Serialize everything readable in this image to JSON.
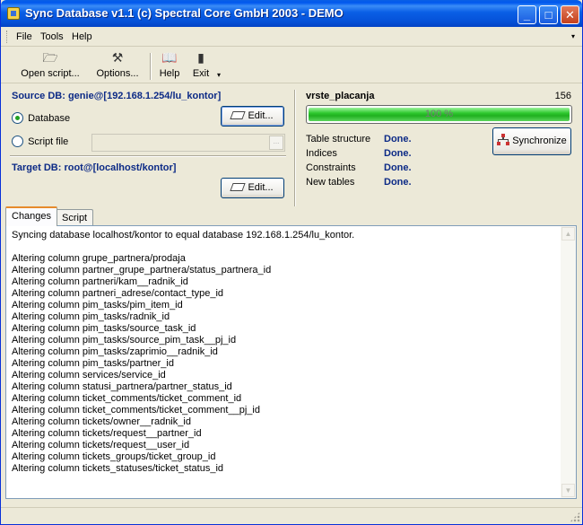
{
  "window": {
    "title": "Sync Database v1.1 (c) Spectral Core GmbH 2003 - DEMO",
    "controls": {
      "minimize": "_",
      "maximize": "□",
      "close": "✕"
    }
  },
  "menu": {
    "items": [
      "File",
      "Tools",
      "Help"
    ],
    "overflow": "▾"
  },
  "toolbar": {
    "open_script": "Open script...",
    "options": "Options...",
    "help": "Help",
    "exit": "Exit",
    "dropdown": "▾",
    "icons": {
      "open_script": "folder-open-icon",
      "options": "wrench-icon",
      "help": "book-icon",
      "exit": "door-icon"
    }
  },
  "source": {
    "label": "Source DB: genie@[192.168.1.254/lu_kontor]",
    "edit_label": "Edit...",
    "radio_database": "Database",
    "radio_script": "Script file",
    "selected": "Database",
    "script_file_value": "",
    "browse": "..."
  },
  "target": {
    "label": "Target DB: root@[localhost/kontor]",
    "edit_label": "Edit..."
  },
  "progress": {
    "current_table": "vrste_placanja",
    "count": "156",
    "percent_label": "100 %",
    "fraction": 1.0
  },
  "status": [
    {
      "label": "Table structure",
      "value": "Done."
    },
    {
      "label": "Indices",
      "value": "Done."
    },
    {
      "label": "Constraints",
      "value": "Done."
    },
    {
      "label": "New tables",
      "value": "Done."
    }
  ],
  "synchronize_label": "Synchronize",
  "tabs": [
    {
      "label": "Changes",
      "active": true
    },
    {
      "label": "Script",
      "active": false
    }
  ],
  "log": [
    "Syncing database localhost/kontor to equal database 192.168.1.254/lu_kontor.",
    "",
    "Altering column grupe_partnera/prodaja",
    "Altering column partner_grupe_partnera/status_partnera_id",
    "Altering column partneri/kam__radnik_id",
    "Altering column partneri_adrese/contact_type_id",
    "Altering column pim_tasks/pim_item_id",
    "Altering column pim_tasks/radnik_id",
    "Altering column pim_tasks/source_task_id",
    "Altering column pim_tasks/source_pim_task__pj_id",
    "Altering column pim_tasks/zaprimio__radnik_id",
    "Altering column pim_tasks/partner_id",
    "Altering column services/service_id",
    "Altering column statusi_partnera/partner_status_id",
    "Altering column ticket_comments/ticket_comment_id",
    "Altering column ticket_comments/ticket_comment__pj_id",
    "Altering column tickets/owner__radnik_id",
    "Altering column tickets/request__partner_id",
    "Altering column tickets/request__user_id",
    "Altering column tickets_groups/ticket_group_id",
    "Altering column tickets_statuses/ticket_status_id"
  ],
  "scrollbar": {
    "up": "▲",
    "down": "▼"
  }
}
